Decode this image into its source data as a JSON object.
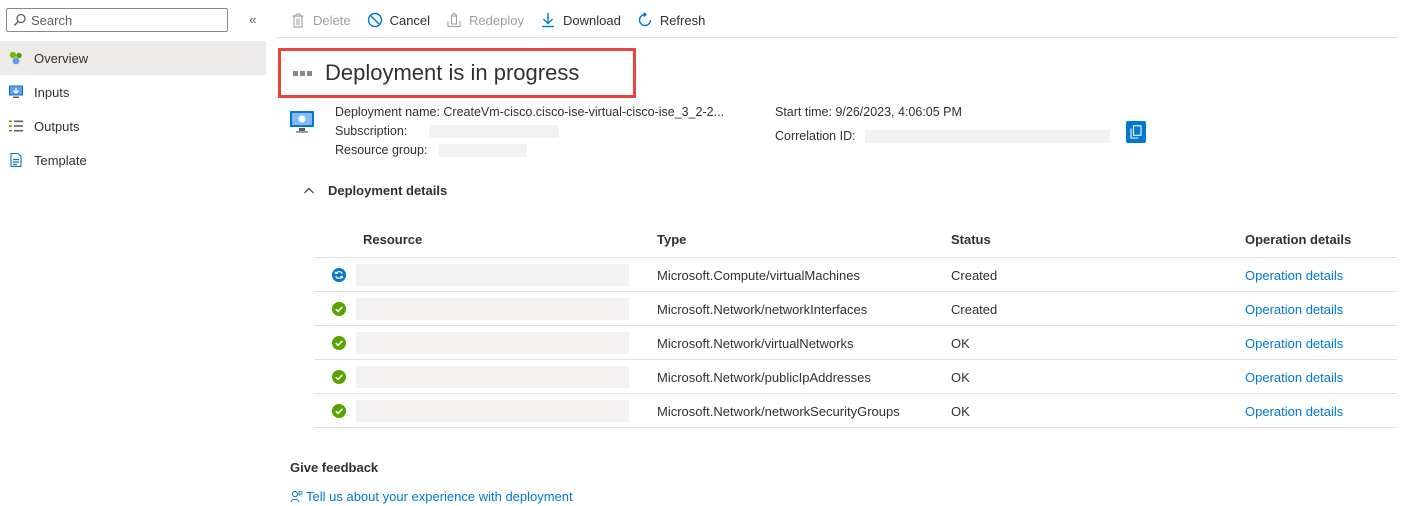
{
  "sidebar": {
    "search_placeholder": "Search",
    "collapse_glyph": "«",
    "items": [
      {
        "label": "Overview",
        "icon": "overview-icon",
        "active": true
      },
      {
        "label": "Inputs",
        "icon": "inputs-icon",
        "active": false
      },
      {
        "label": "Outputs",
        "icon": "outputs-icon",
        "active": false
      },
      {
        "label": "Template",
        "icon": "template-icon",
        "active": false
      }
    ]
  },
  "toolbar": {
    "delete_label": "Delete",
    "cancel_label": "Cancel",
    "redeploy_label": "Redeploy",
    "download_label": "Download",
    "refresh_label": "Refresh"
  },
  "title": "Deployment is in progress",
  "summary": {
    "deployment_name_label": "Deployment name:",
    "deployment_name_value": "CreateVm-cisco.cisco-ise-virtual-cisco-ise_3_2-2...",
    "subscription_label": "Subscription:",
    "resource_group_label": "Resource group:",
    "start_time_label": "Start time:",
    "start_time_value": "9/26/2023, 4:06:05 PM",
    "correlation_id_label": "Correlation ID:"
  },
  "details": {
    "header": "Deployment details",
    "columns": {
      "resource": "Resource",
      "type": "Type",
      "status": "Status",
      "operation": "Operation details"
    },
    "rows": [
      {
        "state": "in-progress",
        "type": "Microsoft.Compute/virtualMachines",
        "status": "Created",
        "operation": "Operation details"
      },
      {
        "state": "success",
        "type": "Microsoft.Network/networkInterfaces",
        "status": "Created",
        "operation": "Operation details"
      },
      {
        "state": "success",
        "type": "Microsoft.Network/virtualNetworks",
        "status": "OK",
        "operation": "Operation details"
      },
      {
        "state": "success",
        "type": "Microsoft.Network/publicIpAddresses",
        "status": "OK",
        "operation": "Operation details"
      },
      {
        "state": "success",
        "type": "Microsoft.Network/networkSecurityGroups",
        "status": "OK",
        "operation": "Operation details"
      }
    ]
  },
  "feedback": {
    "title": "Give feedback",
    "link": "Tell us about your experience with deployment"
  },
  "colors": {
    "accent": "#0078d4",
    "success": "#57a300",
    "highlight_border": "#e8443a"
  }
}
